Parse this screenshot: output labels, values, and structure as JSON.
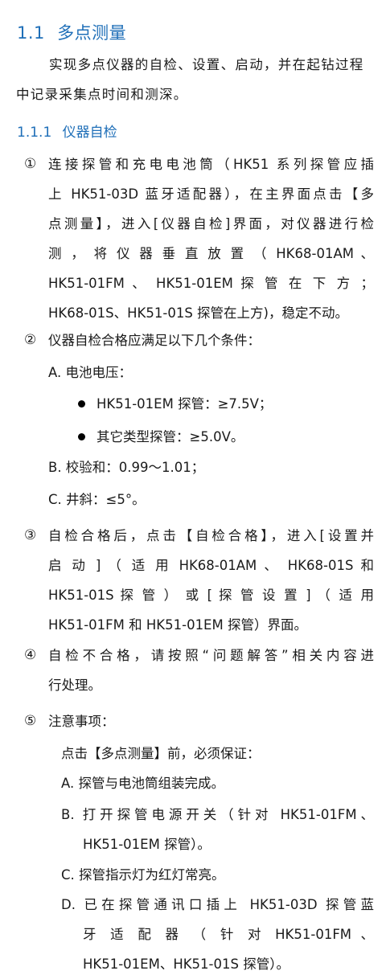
{
  "section": {
    "number": "1.1",
    "title": "多点测量",
    "intro": "实现多点仪器的自检、设置、启动，并在起钻过程中记录采集点时间和测深。"
  },
  "subsection": {
    "number": "1.1.1",
    "title": "仪器自检"
  },
  "items": [
    {
      "num": "①",
      "lines": [
        "连接探管和充电电池筒（HK51 系列探管应插",
        "上 HK51-03D 蓝牙适配器），在主界面点击【多",
        "点测量】，进入[仪器自检]界面，对仪器进行检",
        "测 ， 将 仪 器 垂 直 放 置 （ HK68-01AM 、",
        "HK51-01FM 、 HK51-01EM  探 管 在 下 方 ；",
        "HK68-01S、HK51-01S 探管在上方)，稳定不动。"
      ]
    },
    {
      "num": "②",
      "lines": [
        "仪器自检合格应满足以下几个条件："
      ],
      "conditions": {
        "a": "A. 电池电压：",
        "a_bullets": [
          "HK51-01EM 探管：≥7.5V；",
          "其它类型探管：≥5.0V。"
        ],
        "b": "B. 校验和：0.99～1.01；",
        "c": "C. 井斜：≤5°。"
      }
    },
    {
      "num": "③",
      "lines": [
        "自检合格后，点击【自检合格】，进入[设置并",
        "启 动 ] （ 适 用  HK68-01AM 、 HK68-01S  和",
        "HK51-01S  探 管 ） 或 [ 探 管 设 置 ] （ 适 用",
        "HK51-01FM 和 HK51-01EM 探管）界面。"
      ]
    },
    {
      "num": "④",
      "lines": [
        "自检不合格，请按照“问题解答”相关内容进",
        "行处理。"
      ]
    },
    {
      "num": "⑤",
      "lines": [
        "注意事项："
      ],
      "notes": {
        "lead": "点击【多点测量】前，必须保证：",
        "a": "A. 探管与电池筒组装完成。",
        "b_lines": [
          "B. 打开探管电源开关（针对 HK51-01FM、",
          "HK51-01EM 探管）。"
        ],
        "c": "C. 探管指示灯为红灯常亮。",
        "d_lines": [
          "D.  已在探管通讯口插上 HK51-03D 探管蓝",
          "牙 适 配 器 （ 针 对  HK51-01FM 、",
          "HK51-01EM、HK51-01S 探管）。"
        ]
      }
    }
  ],
  "colors": {
    "heading": "#1f6fb8",
    "body": "#1a1a1a"
  }
}
